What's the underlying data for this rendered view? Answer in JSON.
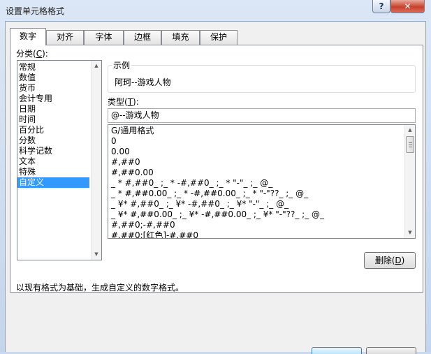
{
  "window": {
    "title": "设置单元格格式",
    "help_label": "?",
    "close_label": "✕",
    "accent_color": "#3399ff"
  },
  "tabs": [
    {
      "label": "数字",
      "active": true
    },
    {
      "label": "对齐",
      "active": false
    },
    {
      "label": "字体",
      "active": false
    },
    {
      "label": "边框",
      "active": false
    },
    {
      "label": "填充",
      "active": false
    },
    {
      "label": "保护",
      "active": false
    }
  ],
  "category": {
    "label_text": "分类(",
    "label_key": "C",
    "label_end": "):",
    "items": [
      "常规",
      "数值",
      "货币",
      "会计专用",
      "日期",
      "时间",
      "百分比",
      "分数",
      "科学记数",
      "文本",
      "特殊",
      "自定义"
    ],
    "selected": "自定义"
  },
  "sample": {
    "label": "示例",
    "value": "阿珂--游戏人物"
  },
  "type": {
    "label_text": "类型(",
    "label_key": "T",
    "label_end": "):",
    "input_value": "@--游戏人物",
    "formats": [
      "G/通用格式",
      "0",
      "0.00",
      "#,##0",
      "#,##0.00",
      "_ * #,##0_ ;_ * -#,##0_ ;_ * \"-\"_ ;_ @_",
      "_ * #,##0.00_ ;_ * -#,##0.00_ ;_ * \"-\"??_ ;_ @_",
      "_ ¥* #,##0_ ;_ ¥* -#,##0_ ;_ ¥* \"-\"_ ;_ @_",
      "_ ¥* #,##0.00_ ;_ ¥* -#,##0.00_ ;_ ¥* \"-\"??_ ;_ @_",
      "#,##0;-#,##0",
      "#,##0;[红色]-#,##0"
    ]
  },
  "delete_button": {
    "label_text": "删除(",
    "label_key": "D",
    "label_end": ")"
  },
  "description": "以现有格式为基础，生成自定义的数字格式。",
  "footer": {
    "ok_label": "",
    "cancel_label": ""
  },
  "icons": {
    "scroll_up": "▲",
    "scroll_down": "▼"
  }
}
